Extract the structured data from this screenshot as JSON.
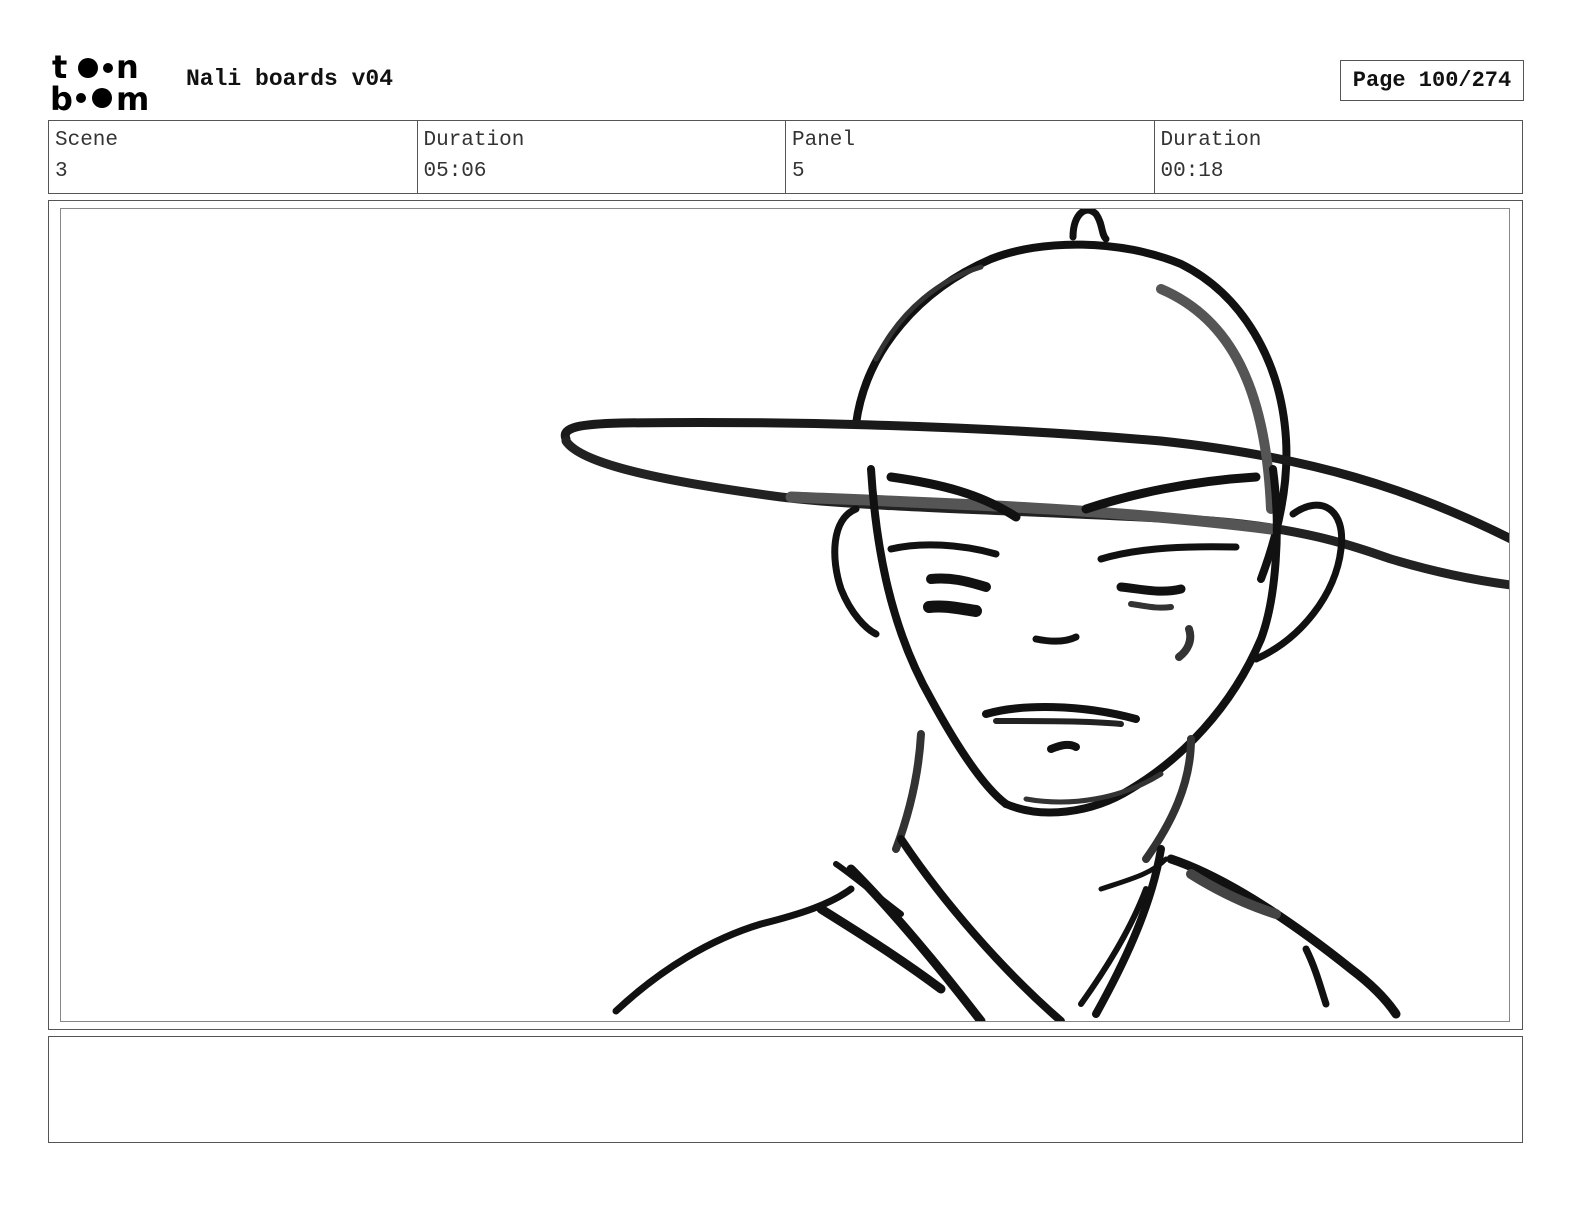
{
  "header": {
    "logo_name": "toon boom logo",
    "doc_title": "Nali boards v04",
    "page_label": "Page 100/274"
  },
  "info": {
    "scene_label": "Scene",
    "scene_value": "3",
    "scene_duration_label": "Duration",
    "scene_duration_value": "05:06",
    "panel_label": "Panel",
    "panel_value": "5",
    "panel_duration_label": "Duration",
    "panel_duration_value": "00:18"
  },
  "panel": {
    "sketch": "boy-with-wide-brim-hat"
  },
  "notes": {
    "text": ""
  }
}
